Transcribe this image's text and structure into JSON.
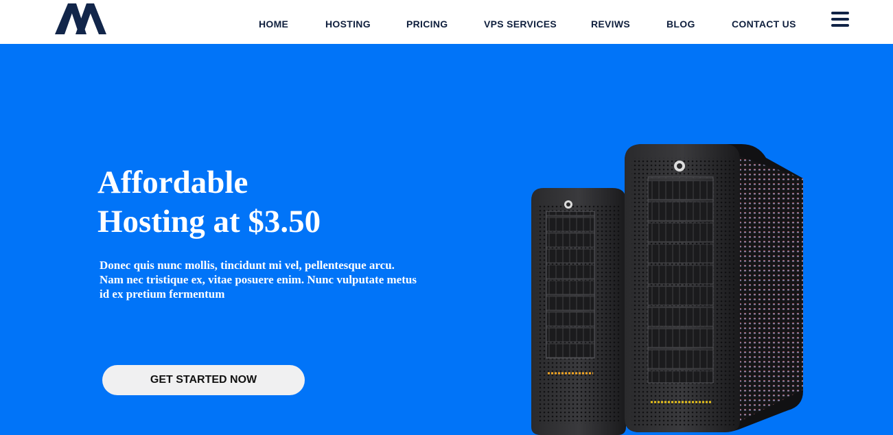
{
  "nav": {
    "items": [
      {
        "label": "HOME"
      },
      {
        "label": "HOSTING"
      },
      {
        "label": "PRICING"
      },
      {
        "label": "VPS SERVICES"
      },
      {
        "label": "REVIWS"
      },
      {
        "label": "BLOG"
      },
      {
        "label": "CONTACT US"
      }
    ],
    "menu_icon": "hamburger-menu-icon"
  },
  "logo": {
    "icon": "brand-logo-icon"
  },
  "hero": {
    "title_line1": "Affordable",
    "title_line2": "Hosting at $3.50",
    "desc_line1": "Donec quis nunc mollis, tincidunt mi vel, pellentesque arcu.",
    "desc_line2": "Nam nec tristique ex, vitae posuere enim. Nunc vulputate metus",
    "desc_line3": "id ex pretium fermentum",
    "cta_label": "GET STARTED NOW",
    "image": "server-towers-illustration"
  },
  "colors": {
    "hero_bg": "#0174f8",
    "nav_text": "#0f1f3d",
    "logo": "#12264a",
    "cta_bg": "#f0f0f1"
  }
}
